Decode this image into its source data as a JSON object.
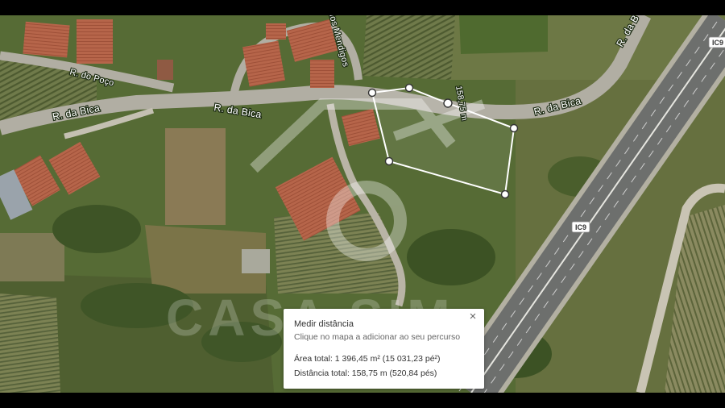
{
  "map": {
    "roads": {
      "r_bica_left": "R. da Bica",
      "r_bica_mid": "R. da Bica",
      "r_bica_right": "R. da Bica",
      "r_bica_top": "R. da B",
      "r_poco": "R. do Poço",
      "r_mendigos": "dos Mendigos",
      "highway_top": "IC9",
      "highway_mid": "IC9"
    },
    "measure_segment_label": "158,75 m",
    "watermark_text": "CASA SIM"
  },
  "info_card": {
    "title": "Medir distância",
    "hint": "Clique no mapa a adicionar ao seu percurso",
    "area": "Área total: 1 396,45 m² (15 031,23 pé²)",
    "distance": "Distância total: 158,75 m (520,84 pés)",
    "close_label": "×"
  }
}
